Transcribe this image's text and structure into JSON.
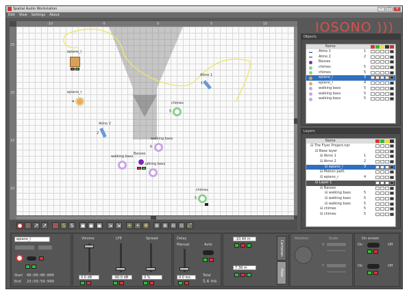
{
  "window": {
    "title": "Spatial Audio Workstation",
    "min": "–",
    "max": "□",
    "close": "×"
  },
  "menu": [
    "Edit",
    "View",
    "Settings",
    "About"
  ],
  "logo": "IOSONO )))",
  "rulers": {
    "top": [
      "-10",
      "-5",
      "0",
      "5",
      "10"
    ],
    "left": [
      "25",
      "20",
      "15",
      "10"
    ]
  },
  "sources": [
    {
      "label": "epiano_l",
      "num": "",
      "color": "#d9a05b"
    },
    {
      "label": "epiano_r",
      "num": "4",
      "color": "#e0b062"
    },
    {
      "label": "Atmo 1",
      "num": "1",
      "color": "#6a9ad6"
    },
    {
      "label": "Atmo 2",
      "num": "2",
      "color": "#6a9ad6"
    },
    {
      "label": "chimes",
      "num": "5",
      "color": "#8cd08c"
    },
    {
      "label": "walking bass",
      "num": "6",
      "color": "#c9a5e6"
    },
    {
      "label": "walking bass",
      "num": "",
      "color": "#c9a5e6"
    },
    {
      "label": "walking bass",
      "num": "",
      "color": "#c9a5e6"
    },
    {
      "label": "Basses",
      "num": "",
      "color": "#7a2bb5"
    },
    {
      "label": "chimes",
      "num": "5",
      "color": "#8cd08c"
    }
  ],
  "objects": {
    "title": "Objects",
    "header": "Name",
    "rows": [
      {
        "name": "Atmo 1",
        "num": "1",
        "icon": "line",
        "color": "#1b2a7a"
      },
      {
        "name": "Atmo 2",
        "num": "2",
        "icon": "line",
        "color": "#1b2a7a"
      },
      {
        "name": "Basses",
        "num": "",
        "icon": "dot",
        "color": "#7a2bb5"
      },
      {
        "name": "chimes",
        "num": "5",
        "icon": "dot",
        "color": "#8cd08c"
      },
      {
        "name": "chimes",
        "num": "5",
        "icon": "dot",
        "color": "#8cd08c"
      },
      {
        "name": "epiano_l",
        "num": "3",
        "icon": "dot",
        "color": "#d9a05b"
      },
      {
        "name": "epiano_r",
        "num": "4",
        "icon": "dot",
        "color": "#e0b062"
      },
      {
        "name": "walking bass",
        "num": "5",
        "icon": "dot",
        "color": "#c9a5e6"
      },
      {
        "name": "walking bass",
        "num": "5",
        "icon": "dot",
        "color": "#c9a5e6"
      },
      {
        "name": "walking bass",
        "num": "5",
        "icon": "dot",
        "color": "#c9a5e6"
      }
    ]
  },
  "layers": {
    "title": "Layers",
    "header": "Name",
    "rows": [
      {
        "name": "The Flyer Project.npr",
        "num": "",
        "indent": 0,
        "style": ""
      },
      {
        "name": "Base layer",
        "num": "",
        "indent": 1,
        "style": ""
      },
      {
        "name": "Atmo 1",
        "num": "1",
        "indent": 2,
        "style": ""
      },
      {
        "name": "Atmo 2",
        "num": "2",
        "indent": 2,
        "style": ""
      },
      {
        "name": "epiano_l",
        "num": "3",
        "indent": 3,
        "style": "sel"
      },
      {
        "name": "Motion path",
        "num": "",
        "indent": 2,
        "style": ""
      },
      {
        "name": "epiano_r",
        "num": "4",
        "indent": 2,
        "style": ""
      },
      {
        "name": "Layer 1",
        "num": "",
        "indent": 1,
        "style": "sel2"
      },
      {
        "name": "Basses",
        "num": "",
        "indent": 2,
        "style": ""
      },
      {
        "name": "walking bass",
        "num": "5",
        "indent": 3,
        "style": ""
      },
      {
        "name": "walking bass",
        "num": "5",
        "indent": 3,
        "style": ""
      },
      {
        "name": "walking bass",
        "num": "5",
        "indent": 3,
        "style": ""
      },
      {
        "name": "chimes",
        "num": "5",
        "indent": 2,
        "style": ""
      },
      {
        "name": "chimes",
        "num": "5",
        "indent": 2,
        "style": ""
      }
    ]
  },
  "bottom": {
    "name_field": "epiano_l",
    "volume_label": "Volume",
    "lfe_label": "LFE",
    "spread_label": "Spread",
    "delay_label": "Delay",
    "manual_label": "Manual",
    "auto_label": "Auto",
    "total_label": "Total",
    "total_value": "5.6 ms",
    "start_label": "Start",
    "end_label": "End",
    "start_time": "00:00:00:000",
    "end_time": "23:59:59:999",
    "volume_value": "0.0 dB",
    "lfe_value": "-90.0 dB",
    "spread_value": "0 %",
    "delay_value": "0.0 ms",
    "x_value": "-10.44 m",
    "y_value": "7.38 m",
    "tab_cartesian": "Cartesian",
    "tab_polar": "Polar",
    "rotation_label": "Rotation",
    "scale_label": "Scale",
    "scale_x": "X",
    "scale_y": "Y",
    "on_screen_label": "On screen",
    "on_label": "On",
    "off_label": "Off"
  }
}
